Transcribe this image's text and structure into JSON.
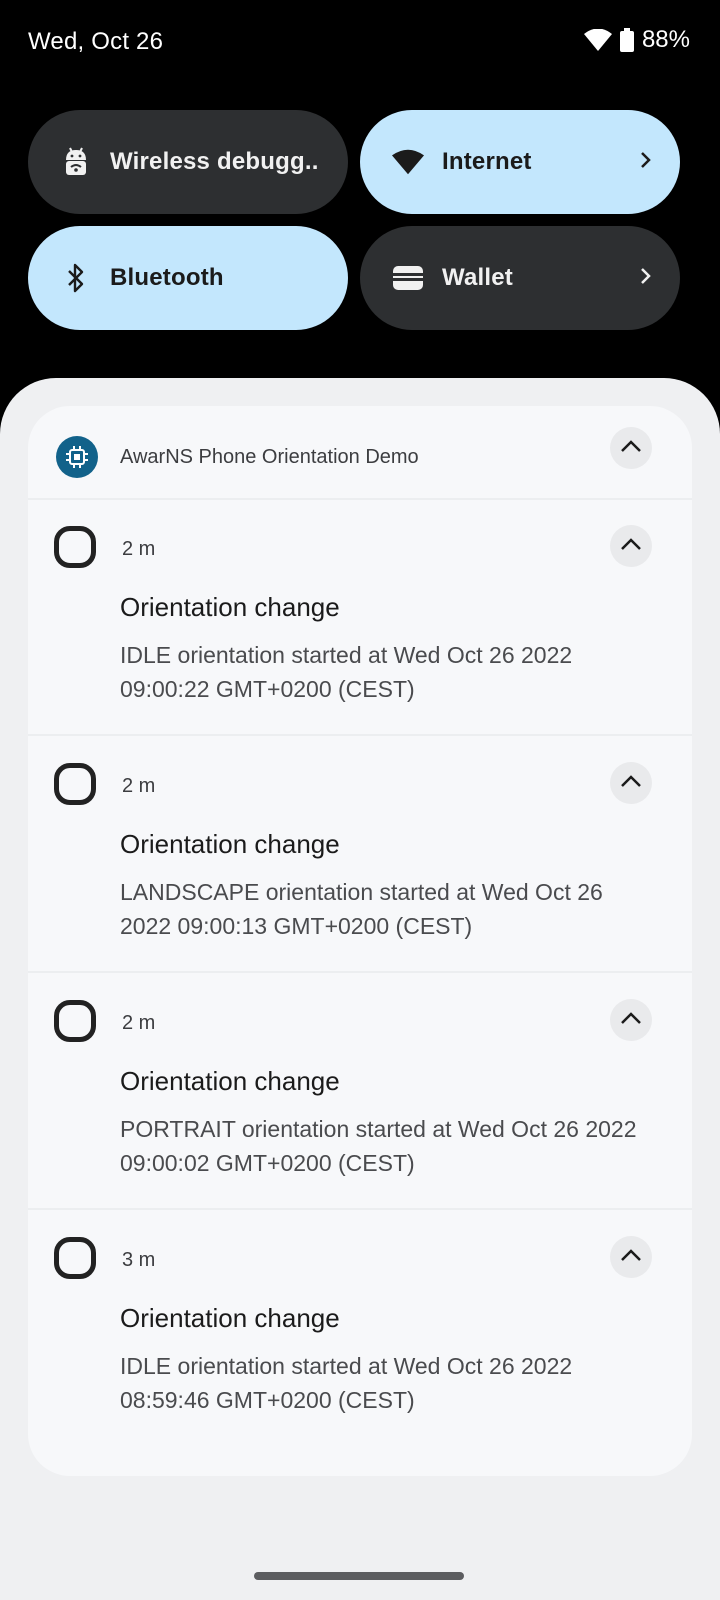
{
  "status_bar": {
    "date": "Wed, Oct 26",
    "battery_percent": "88%",
    "icons": [
      "wifi-icon",
      "battery-icon"
    ]
  },
  "quick_tiles": [
    {
      "label": "Wireless debugg..",
      "icon": "android-debug-icon",
      "state": "off",
      "has_chevron": false
    },
    {
      "label": "Internet",
      "icon": "wifi-icon",
      "state": "on",
      "has_chevron": true
    },
    {
      "label": "Bluetooth",
      "icon": "bluetooth-icon",
      "state": "on",
      "has_chevron": false
    },
    {
      "label": "Wallet",
      "icon": "wallet-icon",
      "state": "off",
      "has_chevron": true
    }
  ],
  "notification_group": {
    "app_name": "AwarNS Phone Orientation Demo",
    "app_icon": "chip-icon",
    "notifications": [
      {
        "time": "2 m",
        "title": "Orientation change",
        "body": "IDLE orientation started at Wed Oct 26 2022 09:00:22 GMT+0200 (CEST)"
      },
      {
        "time": "2 m",
        "title": "Orientation change",
        "body": "LANDSCAPE orientation started at Wed Oct 26 2022 09:00:13 GMT+0200 (CEST)"
      },
      {
        "time": "2 m",
        "title": "Orientation change",
        "body": "PORTRAIT orientation started at Wed Oct 26 2022 09:00:02 GMT+0200 (CEST)"
      },
      {
        "time": "3 m",
        "title": "Orientation change",
        "body": "IDLE orientation started at Wed Oct 26 2022 08:59:46 GMT+0200 (CEST)"
      }
    ]
  },
  "colors": {
    "tile_on": "#c3e7fd",
    "tile_off": "#2d2f31",
    "shade_bg": "#eff0f2",
    "app_icon_bg": "#12628a"
  }
}
